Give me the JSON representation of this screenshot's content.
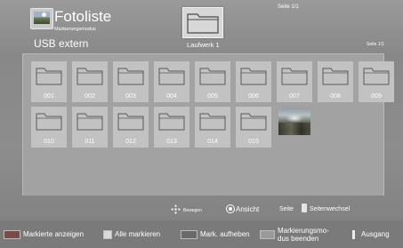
{
  "header": {
    "title": "Fotoliste",
    "mode": "Markierungsmodus",
    "source": "USB extern",
    "drive_label": "Laufwerk 1",
    "page_top": "Seite 1/1",
    "page_right": "Seite 1/1"
  },
  "grid": {
    "items": [
      {
        "label": "001",
        "type": "folder"
      },
      {
        "label": "002",
        "type": "folder"
      },
      {
        "label": "003",
        "type": "folder"
      },
      {
        "label": "004",
        "type": "folder"
      },
      {
        "label": "005",
        "type": "folder"
      },
      {
        "label": "006",
        "type": "folder"
      },
      {
        "label": "007",
        "type": "folder"
      },
      {
        "label": "008",
        "type": "folder"
      },
      {
        "label": "009",
        "type": "folder"
      },
      {
        "label": "010",
        "type": "folder"
      },
      {
        "label": "011",
        "type": "folder"
      },
      {
        "label": "012",
        "type": "folder"
      },
      {
        "label": "013",
        "type": "folder"
      },
      {
        "label": "014",
        "type": "folder"
      },
      {
        "label": "015",
        "type": "folder"
      },
      {
        "label": "",
        "type": "photo"
      }
    ]
  },
  "controls": {
    "move_label": "Bewegen",
    "view_label": "Ansicht",
    "page_label": "Seite",
    "page_change_label": "Seitenwechsel"
  },
  "bottom": {
    "red_label": "Markierte anzeigen",
    "green_label": "Alle markieren",
    "yellow_label": "Mark. aufheben",
    "blue_label": "Markierungsmo-\ndus beenden",
    "exit_label": "Ausgang"
  },
  "colors": {
    "red": "#7b4a4a",
    "green": "#d9d9d9",
    "yellow": "#6a6a6a",
    "blue": "#9a9a9a"
  }
}
